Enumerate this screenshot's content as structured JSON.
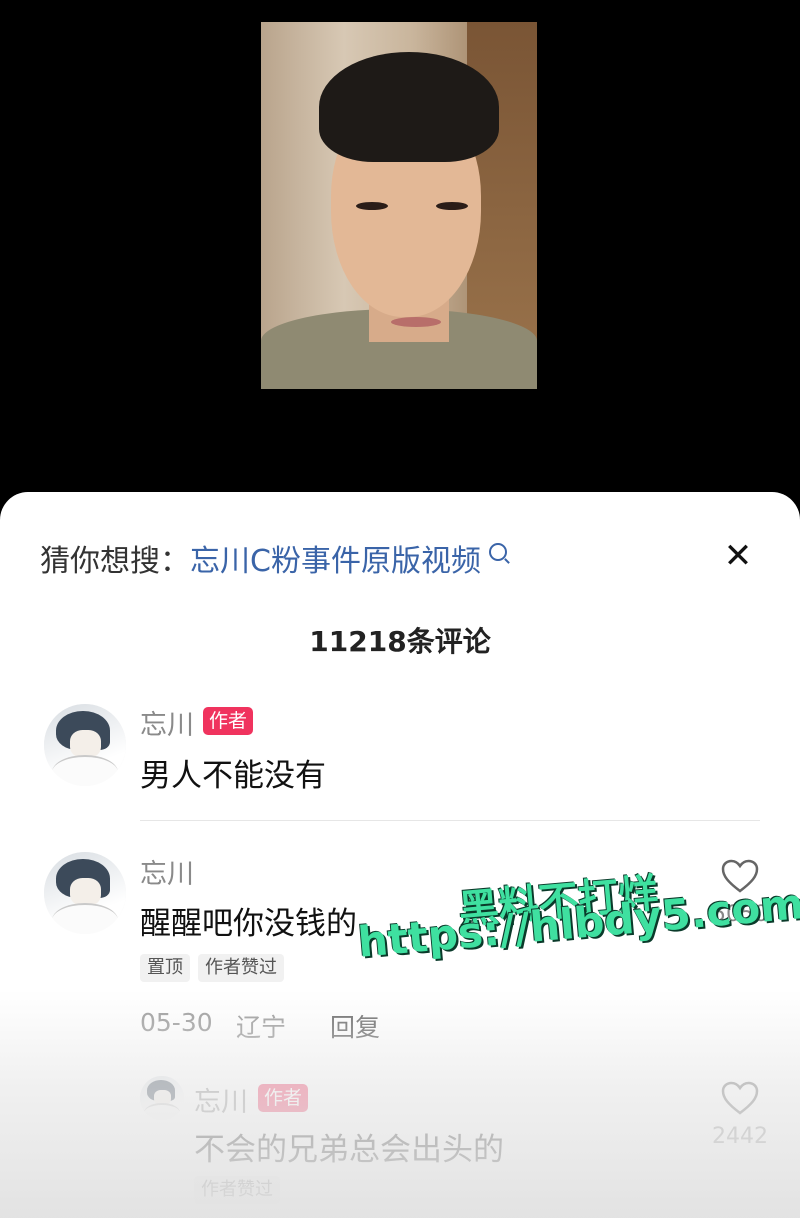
{
  "search": {
    "prefix": "猜你想搜：",
    "term": "忘川C粉事件原版视频"
  },
  "comment_count": "11218条评论",
  "comments": [
    {
      "user": "忘川",
      "badge": "作者",
      "text": "男人不能没有"
    },
    {
      "user": "忘川",
      "text": "醒醒吧你没钱的",
      "tags": [
        "置顶",
        "作者赞过"
      ],
      "date": "05-30",
      "location": "辽宁",
      "reply_label": "回复",
      "likes": "5050"
    },
    {
      "user": "忘川",
      "badge": "作者",
      "text": "不会的兄弟总会出头的",
      "tags": [
        "作者赞过"
      ],
      "likes": "2442"
    }
  ],
  "watermark": {
    "line1": "黑料不打烊",
    "line2": "https://hlbdy5.com"
  },
  "colors": {
    "badge": "#f0335e",
    "search_term": "#3a64a8",
    "watermark": "#3fe0a0"
  },
  "icons": [
    "search-icon",
    "close-icon",
    "heart-icon"
  ]
}
